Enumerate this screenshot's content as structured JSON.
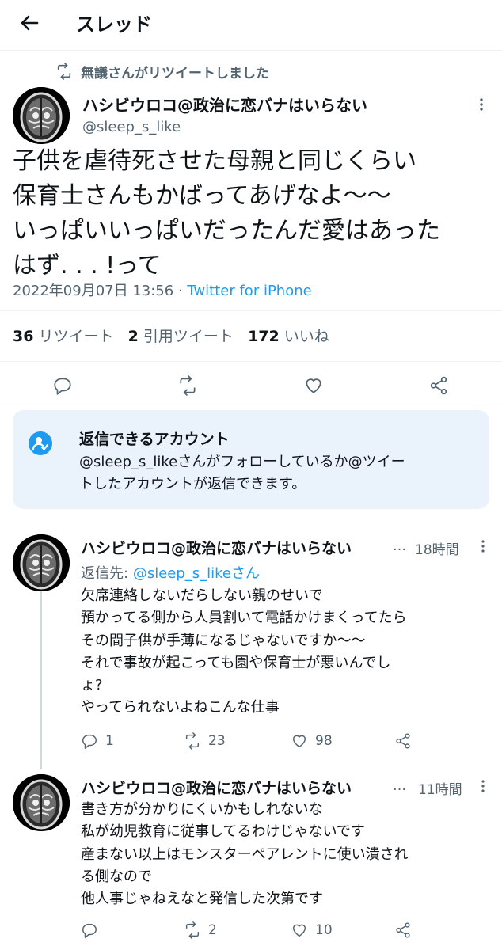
{
  "header": {
    "title": "スレッド"
  },
  "retweet_notice": "無議さんがリツイートしました",
  "main_tweet": {
    "name": "ハシビウロコ@政治に恋バナはいらない",
    "handle": "@sleep_s_like",
    "text": "子供を虐待死させた母親と同じくらい\n保育士さんもかばってあげなよ〜〜\nいっぱいいっぱいだったんだ愛はあった\nはず. . . !って",
    "datetime": "2022年09月07日 13:56",
    "separator": "·",
    "source": "Twitter for iPhone",
    "retweets": {
      "count": "36",
      "label": "リツイート"
    },
    "quotes": {
      "count": "2",
      "label": "引用ツイート"
    },
    "likes": {
      "count": "172",
      "label": "いいね"
    }
  },
  "reply_restriction": {
    "title": "返信できるアカウント",
    "text": "@sleep_s_likeさんがフォローしているか@ツイー\nトしたアカウントが返信できます。"
  },
  "replies": [
    {
      "name": "ハシビウロコ@政治に恋バナはいらない",
      "ellipsis": "…",
      "time": "18時間",
      "reply_to_label": "返信先:",
      "reply_to_handle": "@sleep_s_likeさん",
      "text": "欠席連絡しないだらしない親のせいで\n預かってる側から人員割いて電話かけまくってたら\nその間子供が手薄になるじゃないですか〜〜\nそれで事故が起こっても園や保育士が悪いんでし\nょ?\nやってられないよねこんな仕事",
      "reply_count": "1",
      "retweet_count": "23",
      "like_count": "98"
    },
    {
      "name": "ハシビウロコ@政治に恋バナはいらない",
      "ellipsis": "…",
      "time": "11時間",
      "text": "書き方が分かりにくいかもしれないな\n私が幼児教育に従事してるわけじゃないです\n産まない以上はモンスターペアレントに使い潰され\nる側なので\n他人事じゃねえなと発信した次第です",
      "reply_count": "",
      "retweet_count": "2",
      "like_count": "10"
    }
  ],
  "icons": {
    "back": "back-arrow-icon",
    "retweet": "retweet-icon",
    "reply": "reply-icon",
    "like": "heart-icon",
    "share": "share-icon",
    "more": "more-vertical-icon",
    "restriction": "user-check-icon"
  },
  "colors": {
    "accent": "#1d9bf0",
    "muted": "#536471",
    "text": "#0f1419",
    "notice_bg": "#eaf3fb"
  }
}
